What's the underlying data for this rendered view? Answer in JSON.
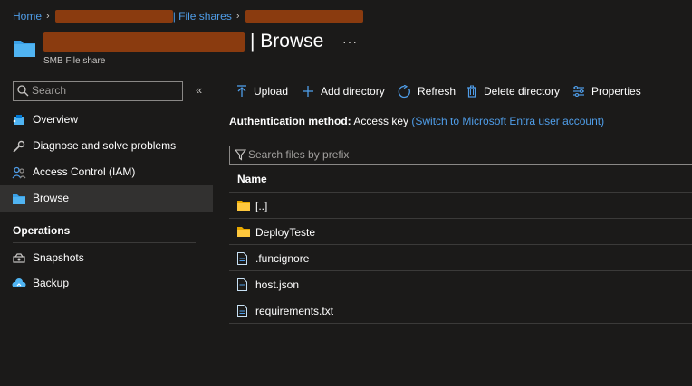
{
  "breadcrumb": {
    "home": "Home",
    "file_shares": "| File shares"
  },
  "header": {
    "title": "| Browse",
    "subtitle": "SMB File share",
    "more": "···"
  },
  "sidebar": {
    "search_placeholder": "Search",
    "collapse": "«",
    "items": [
      {
        "label": "Overview",
        "icon": "overview-icon"
      },
      {
        "label": "Diagnose and solve problems",
        "icon": "wrench-icon"
      },
      {
        "label": "Access Control (IAM)",
        "icon": "people-icon"
      },
      {
        "label": "Browse",
        "icon": "folder-icon",
        "active": true
      }
    ],
    "section_operations": "Operations",
    "operations": [
      {
        "label": "Snapshots",
        "icon": "snapshot-icon"
      },
      {
        "label": "Backup",
        "icon": "backup-cloud-icon"
      }
    ]
  },
  "toolbar": {
    "upload": "Upload",
    "add_directory": "Add directory",
    "refresh": "Refresh",
    "delete_directory": "Delete directory",
    "properties": "Properties"
  },
  "auth": {
    "label": "Authentication method:",
    "value": "Access key",
    "switch_link": "(Switch to Microsoft Entra user account)"
  },
  "file_search": {
    "placeholder": "Search files by prefix"
  },
  "file_table": {
    "header_name": "Name",
    "rows": [
      {
        "name": "[..]",
        "type": "folder"
      },
      {
        "name": "DeployTeste",
        "type": "folder"
      },
      {
        "name": ".funcignore",
        "type": "file"
      },
      {
        "name": "host.json",
        "type": "file"
      },
      {
        "name": "requirements.txt",
        "type": "file"
      }
    ]
  },
  "colors": {
    "background": "#1b1a19",
    "link": "#4f9de8",
    "accent": "#0078d4",
    "folder": "#ffc83d",
    "redaction": "#8a3b0f"
  }
}
